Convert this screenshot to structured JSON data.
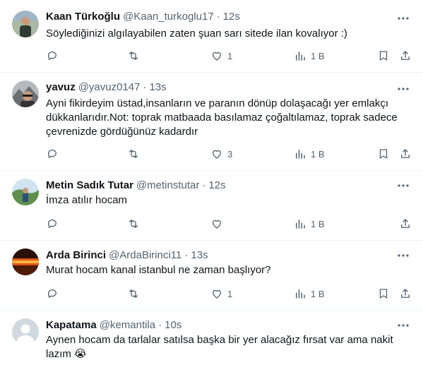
{
  "tweets": [
    {
      "name": "Kaan Türkoğlu",
      "handle": "@Kaan_turkoglu17",
      "time": "12s",
      "text": "Söylediğinizi algılayabilen zaten şuan sarı sitede ilan kovalıyor :)",
      "likes": "1",
      "views": "1 B",
      "avatar_color": "#6f8a7a"
    },
    {
      "name": "yavuz",
      "handle": "@yavuz0147",
      "time": "13s",
      "text": "Ayni fikirdeyim üstad,insanların ve paranın dönüp dolaşacağı yer emlakçı dükkanlarıdır.Not: toprak matbaada basılamaz çoğaltılamaz, toprak sadece çevrenizde gördüğünüz kadardır",
      "likes": "3",
      "views": "1 B",
      "avatar_color": "#8d8d8d"
    },
    {
      "name": "Metin Sadık Tutar",
      "handle": "@metinstutar",
      "time": "12s",
      "text": "İmza atılır hocam",
      "likes": "",
      "views": "1 B",
      "avatar_color": "#7fa36b"
    },
    {
      "name": "Arda Birinci",
      "handle": "@ArdaBirinci11",
      "time": "13s",
      "text": "Murat hocam kanal istanbul ne zaman başlıyor?",
      "likes": "1",
      "views": "1 B",
      "avatar_color": "#3a1a0c"
    },
    {
      "name": "Kapatama",
      "handle": "@kemantila",
      "time": "10s",
      "text": "Aynen hocam da tarlalar satılsa başka bir yer alacağız fırsat var ama nakit lazım 😭",
      "likes": "",
      "views": "",
      "avatar_color": "#cfd9de"
    }
  ],
  "separator": "·",
  "icons": {
    "reply": "reply-icon",
    "retweet": "retweet-icon",
    "like": "like-icon",
    "views": "views-icon",
    "bookmark": "bookmark-icon",
    "share": "share-icon",
    "more": "more-icon"
  }
}
